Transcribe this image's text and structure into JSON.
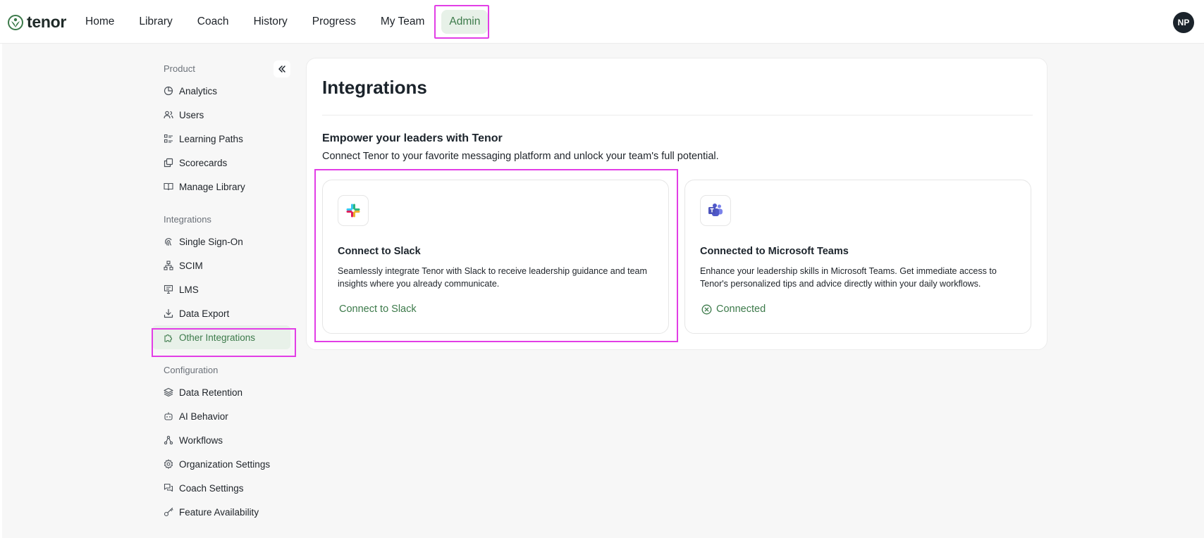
{
  "brand": {
    "name": "tenor",
    "color": "#3c7a4a"
  },
  "nav": {
    "items": [
      {
        "label": "Home"
      },
      {
        "label": "Library"
      },
      {
        "label": "Coach"
      },
      {
        "label": "History"
      },
      {
        "label": "Progress"
      },
      {
        "label": "My Team"
      },
      {
        "label": "Admin",
        "active": true
      }
    ]
  },
  "user": {
    "initials": "NP"
  },
  "sidebar": {
    "product": {
      "label": "Product",
      "items": [
        {
          "label": "Analytics",
          "icon": "pie-chart-icon"
        },
        {
          "label": "Users",
          "icon": "users-icon"
        },
        {
          "label": "Learning Paths",
          "icon": "list-icon"
        },
        {
          "label": "Scorecards",
          "icon": "scorecard-icon"
        },
        {
          "label": "Manage Library",
          "icon": "book-icon"
        }
      ]
    },
    "integrations": {
      "label": "Integrations",
      "items": [
        {
          "label": "Single Sign-On",
          "icon": "fingerprint-icon"
        },
        {
          "label": "SCIM",
          "icon": "network-icon"
        },
        {
          "label": "LMS",
          "icon": "presentation-icon"
        },
        {
          "label": "Data Export",
          "icon": "download-icon"
        },
        {
          "label": "Other Integrations",
          "icon": "puzzle-icon",
          "active": true
        }
      ]
    },
    "configuration": {
      "label": "Configuration",
      "items": [
        {
          "label": "Data Retention",
          "icon": "layers-icon"
        },
        {
          "label": "AI Behavior",
          "icon": "bot-icon"
        },
        {
          "label": "Workflows",
          "icon": "workflow-icon"
        },
        {
          "label": "Organization Settings",
          "icon": "gear-icon"
        },
        {
          "label": "Coach Settings",
          "icon": "chat-icon"
        },
        {
          "label": "Feature Availability",
          "icon": "key-icon"
        }
      ]
    }
  },
  "main": {
    "title": "Integrations",
    "subtitle": "Empower your leaders with Tenor",
    "description": "Connect Tenor to your favorite messaging platform and unlock your team's full potential.",
    "cards": [
      {
        "title": "Connect to Slack",
        "description": "Seamlessly integrate Tenor with Slack to receive leadership guidance and team insights where you already communicate.",
        "action": "Connect to Slack",
        "icon": "slack-icon"
      },
      {
        "title": "Connected to Microsoft Teams",
        "description": "Enhance your leadership skills in Microsoft Teams. Get immediate access to Tenor's personalized tips and advice directly within your daily workflows.",
        "action": "Connected",
        "icon": "microsoft-teams-icon",
        "status_icon": "x-circle-icon"
      }
    ]
  },
  "colors": {
    "accent": "#3c7a4a",
    "active_bg": "#e8f1e9",
    "highlight": "#e23ee6"
  }
}
